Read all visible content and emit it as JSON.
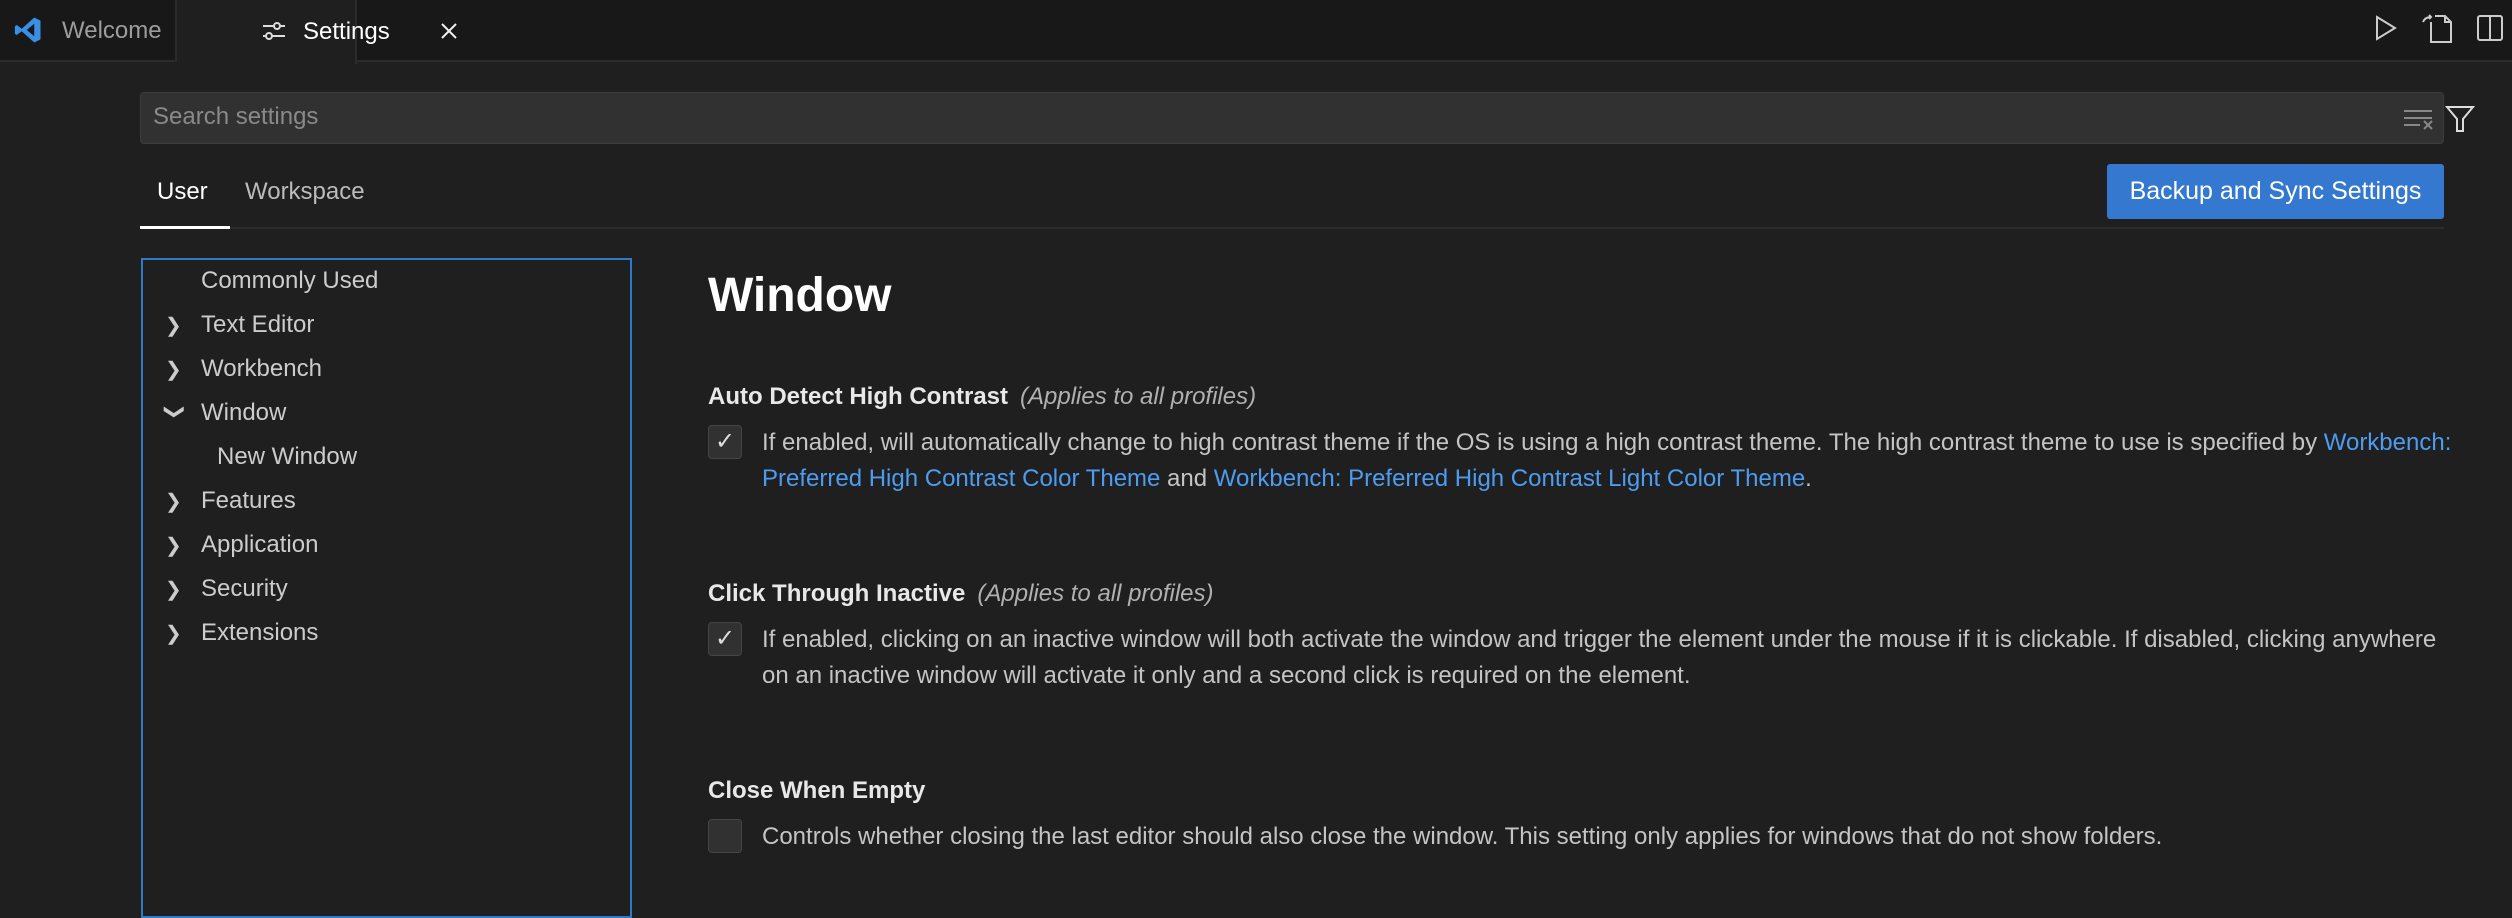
{
  "tabs": [
    {
      "label": "Welcome",
      "icon": "vscode-logo-icon"
    },
    {
      "label": "Settings",
      "icon": "settings-sliders-icon",
      "active": true
    }
  ],
  "toolbar_icons": [
    "run-icon",
    "open-settings-json-icon",
    "split-editor-icon"
  ],
  "search": {
    "placeholder": "Search settings",
    "value": ""
  },
  "scope_tabs": {
    "user": "User",
    "workspace": "Workspace",
    "active": "User"
  },
  "backup_button": "Backup and Sync Settings",
  "tree": [
    {
      "label": "Commonly Used",
      "chevron": ""
    },
    {
      "label": "Text Editor",
      "chevron": "right"
    },
    {
      "label": "Workbench",
      "chevron": "right"
    },
    {
      "label": "Window",
      "chevron": "down"
    },
    {
      "label": "New Window",
      "chevron": "",
      "child": true
    },
    {
      "label": "Features",
      "chevron": "right"
    },
    {
      "label": "Application",
      "chevron": "right"
    },
    {
      "label": "Security",
      "chevron": "right"
    },
    {
      "label": "Extensions",
      "chevron": "right"
    }
  ],
  "section_title": "Window",
  "settings": [
    {
      "title": "Auto Detect High Contrast",
      "scope": "(Applies to all profiles)",
      "checked": true,
      "desc_pre": "If enabled, will automatically change to high contrast theme if the OS is using a high contrast theme. The high contrast theme to use is specified by ",
      "link1": "Workbench: Preferred High Contrast Color Theme",
      "mid": " and ",
      "link2": "Workbench: Preferred High Contrast Light Color Theme",
      "post": "."
    },
    {
      "title": "Click Through Inactive",
      "scope": "(Applies to all profiles)",
      "checked": true,
      "desc": "If enabled, clicking on an inactive window will both activate the window and trigger the element under the mouse if it is clickable. If disabled, clicking anywhere on an inactive window will activate it only and a second click is required on the element."
    },
    {
      "title": "Close When Empty",
      "checked": false,
      "desc": "Controls whether closing the last editor should also close the window. This setting only applies for windows that do not show folders."
    }
  ],
  "colors": {
    "accent": "#3478d0",
    "link": "#4d9cf0",
    "background": "#1f1f1f"
  }
}
